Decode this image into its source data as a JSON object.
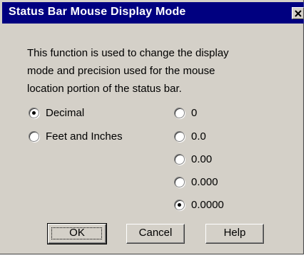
{
  "dialog": {
    "title": "Status Bar Mouse Display Mode",
    "close_icon": "close-icon",
    "description_lines": [
      "This function is used to change the display",
      "mode and precision used for the mouse",
      "location portion of the status bar."
    ]
  },
  "mode_options": [
    {
      "label": "Decimal",
      "selected": true
    },
    {
      "label": "Feet and Inches",
      "selected": false
    }
  ],
  "precision_options": [
    {
      "label": "0",
      "selected": false
    },
    {
      "label": "0.0",
      "selected": false
    },
    {
      "label": "0.00",
      "selected": false
    },
    {
      "label": "0.000",
      "selected": false
    },
    {
      "label": "0.0000",
      "selected": true
    }
  ],
  "buttons": {
    "ok": "OK",
    "cancel": "Cancel",
    "help": "Help"
  },
  "colors": {
    "titlebar": "#000080",
    "face": "#d4d0c8"
  }
}
